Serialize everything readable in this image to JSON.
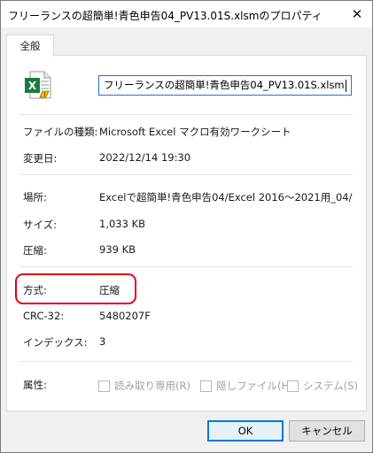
{
  "window": {
    "title": "フリーランスの超簡単!青色申告04_PV13.01S.xlsmのプロパティ"
  },
  "tab": {
    "label": "全般"
  },
  "file": {
    "name": "フリーランスの超簡単!青色申告04_PV13.01S.xlsm",
    "icon": "excel-macro-file-icon"
  },
  "details": {
    "file_type_label": "ファイルの種類:",
    "file_type_value": "Microsoft Excel マクロ有効ワークシート",
    "modified_label": "変更日:",
    "modified_value": "2022/12/14 19:30",
    "location_label": "場所:",
    "location_value": "Excelで超簡単!青色申告04/Excel 2016〜2021用_04/",
    "size_label": "サイズ:",
    "size_value": "1,033 KB",
    "compressed_label": "圧縮:",
    "compressed_value": "939 KB",
    "method_label": "方式:",
    "method_value": "圧縮",
    "crc_label": "CRC-32:",
    "crc_value": "5480207F",
    "index_label": "インデックス:",
    "index_value": "3",
    "attributes_label": "属性:"
  },
  "attributes": {
    "readonly": "読み取り専用(R)",
    "hidden": "隠しファイル(H)",
    "system": "システム(S)"
  },
  "buttons": {
    "ok": "OK",
    "cancel": "キャンセル"
  },
  "colors": {
    "highlight": "#e3001b",
    "focus": "#0078d7",
    "excel_green": "#1d7a3e"
  }
}
